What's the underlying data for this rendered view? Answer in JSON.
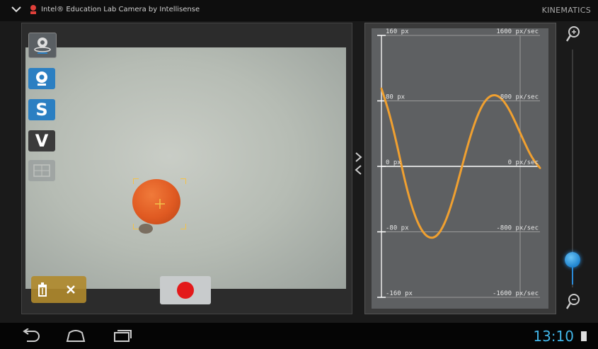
{
  "topbar": {
    "app_title": "Intel® Education Lab Camera by Intellisense",
    "mode_title": "KINEMATICS"
  },
  "tools": {
    "s_label": "S",
    "v_label": "V"
  },
  "chart_data": {
    "type": "line",
    "position_axis": {
      "tick_labels": [
        "160 px",
        "80 px",
        "0 px",
        "-80 px",
        "-160 px"
      ],
      "ticks": [
        160,
        80,
        0,
        -80,
        -160
      ],
      "ylim": [
        -160,
        160
      ]
    },
    "velocity_axis": {
      "tick_labels": [
        "1600 px/sec",
        "800 px/sec",
        "0 px/sec",
        "-800 px/sec",
        "-1600 px/sec"
      ],
      "ticks": [
        1600,
        800,
        0,
        -800,
        -1600
      ],
      "ylim": [
        -1600,
        1600
      ]
    },
    "series": [
      {
        "color": "#f0a030",
        "x": [
          0,
          0.05,
          0.1,
          0.15,
          0.2,
          0.25,
          0.3,
          0.35,
          0.4,
          0.45,
          0.5,
          0.55,
          0.6,
          0.65,
          0.7,
          0.75,
          0.8,
          0.85,
          0.9,
          0.95,
          1.0
        ],
        "values": [
          950,
          650,
          250,
          -200,
          -550,
          -780,
          -880,
          -860,
          -700,
          -420,
          -60,
          300,
          600,
          800,
          880,
          850,
          720,
          520,
          300,
          100,
          -20
        ]
      }
    ],
    "xlim": [
      0,
      1
    ],
    "grid": true
  },
  "statusbar": {
    "clock": "13:10"
  },
  "colors": {
    "accent_blue": "#2b7fc2",
    "series_orange": "#f0a030",
    "record_red": "#e3191a",
    "clock_blue": "#41b5e8"
  }
}
